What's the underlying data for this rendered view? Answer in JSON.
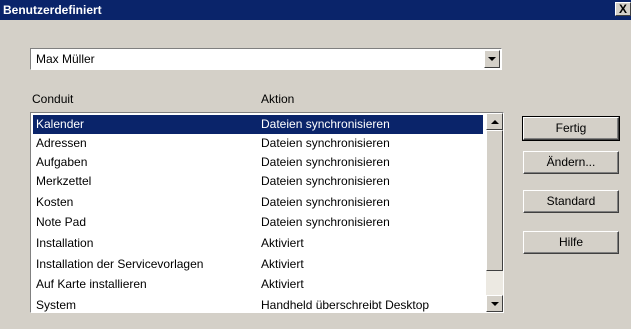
{
  "window": {
    "title": "Benutzerdefiniert",
    "close_label": "X"
  },
  "user_combo": {
    "value": "Max Müller"
  },
  "columns": {
    "conduit": "Conduit",
    "aktion": "Aktion"
  },
  "rows": [
    {
      "conduit": "Kalender",
      "aktion": "Dateien synchronisieren",
      "selected": true
    },
    {
      "conduit": "Adressen",
      "aktion": "Dateien synchronisieren"
    },
    {
      "conduit": "Aufgaben",
      "aktion": "Dateien synchronisieren"
    },
    {
      "conduit": "Merkzettel",
      "aktion": "Dateien synchronisieren"
    },
    {
      "conduit": "Kosten",
      "aktion": "Dateien synchronisieren"
    },
    {
      "conduit": "Note Pad",
      "aktion": "Dateien synchronisieren"
    },
    {
      "conduit": "Installation",
      "aktion": "Aktiviert"
    },
    {
      "conduit": "Installation der Servicevorlagen",
      "aktion": "Aktiviert"
    },
    {
      "conduit": "Auf Karte installieren",
      "aktion": "Aktiviert"
    },
    {
      "conduit": "System",
      "aktion": "Handheld überschreibt Desktop"
    }
  ],
  "buttons": {
    "fertig": "Fertig",
    "aendern": "Ändern...",
    "standard": "Standard",
    "hilfe": "Hilfe"
  },
  "colors": {
    "titlebar": "#0a246a",
    "selection": "#0a246a",
    "face": "#d4d0c8"
  }
}
